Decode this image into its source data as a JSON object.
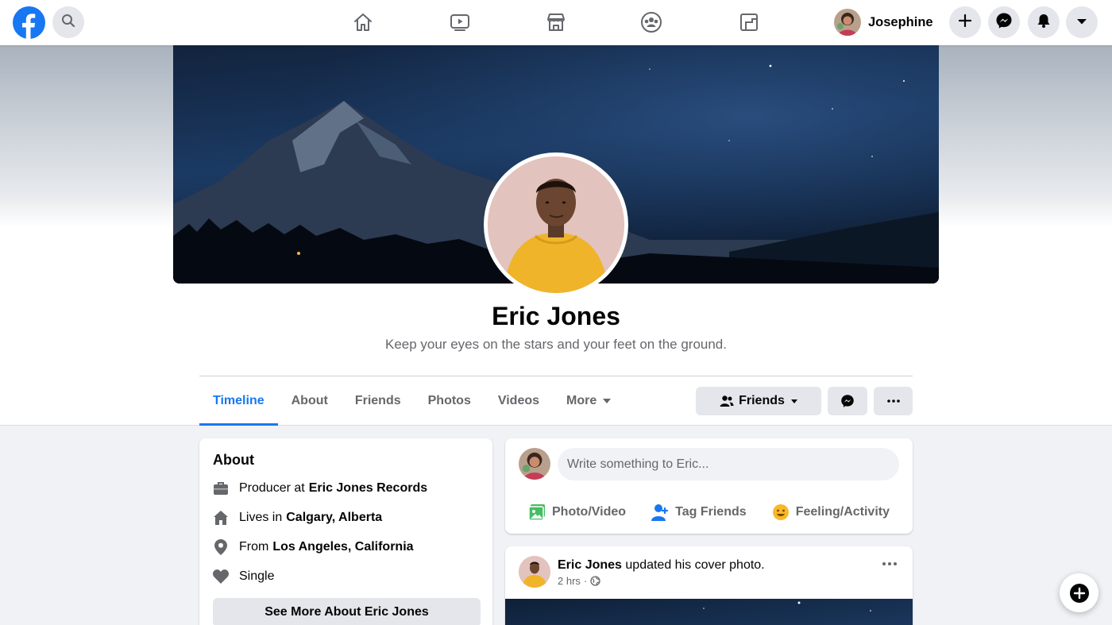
{
  "nav": {
    "user_name": "Josephine",
    "icons": [
      "facebook-logo",
      "search-icon",
      "home-icon",
      "watch-icon",
      "marketplace-icon",
      "groups-icon",
      "gaming-icon",
      "plus-icon",
      "messenger-icon",
      "bell-icon",
      "chevron-down-icon"
    ],
    "brand_color": "#1877f2"
  },
  "profile": {
    "name": "Eric Jones",
    "bio": "Keep your eyes on the stars and your feet on the ground."
  },
  "tabs": [
    {
      "label": "Timeline",
      "active": true
    },
    {
      "label": "About",
      "active": false
    },
    {
      "label": "Friends",
      "active": false
    },
    {
      "label": "Photos",
      "active": false
    },
    {
      "label": "Videos",
      "active": false
    },
    {
      "label": "More",
      "active": false
    }
  ],
  "actions": {
    "friends_label": "Friends"
  },
  "about": {
    "title": "About",
    "rows": [
      {
        "icon": "briefcase-icon",
        "prefix": "Producer at",
        "value": "Eric Jones Records"
      },
      {
        "icon": "home-icon",
        "prefix": "Lives in",
        "value": "Calgary, Alberta"
      },
      {
        "icon": "location-pin-icon",
        "prefix": "From",
        "value": "Los Angeles, California"
      },
      {
        "icon": "heart-icon",
        "prefix": "Single",
        "value": ""
      }
    ],
    "see_more_label": "See More About Eric Jones"
  },
  "composer": {
    "placeholder": "Write something to Eric...",
    "actions": [
      {
        "icon": "photo-video-icon",
        "label": "Photo/Video",
        "color": "#45bd62"
      },
      {
        "icon": "tag-friends-icon",
        "label": "Tag Friends",
        "color": "#1877f2"
      },
      {
        "icon": "feeling-icon",
        "label": "Feeling/Activity",
        "color": "#f7b928"
      }
    ]
  },
  "post": {
    "author": "Eric Jones",
    "action_text": "updated his cover photo.",
    "time": "2 hrs",
    "privacy_icon": "globe-icon"
  }
}
